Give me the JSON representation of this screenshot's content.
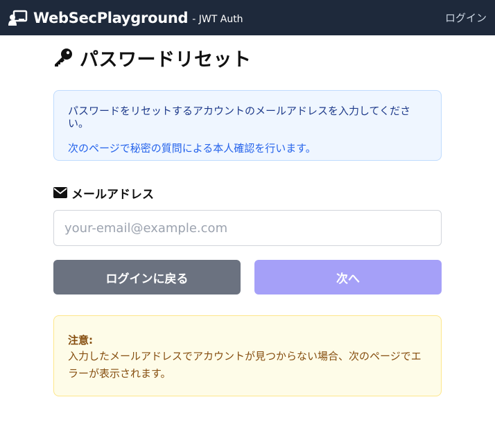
{
  "navbar": {
    "brand_title": "WebSecPlayground",
    "brand_sub": "- JWT Auth",
    "login_link": "ログイン",
    "brand_icon": "chalkboard-user-icon"
  },
  "page": {
    "title": "パスワードリセット",
    "title_icon": "key-icon"
  },
  "info": {
    "line1": "パスワードをリセットするアカウントのメールアドレスを入力してください。",
    "line2": "次のページで秘密の質問による本人確認を行います。"
  },
  "form": {
    "email_label": "メールアドレス",
    "email_icon": "envelope-icon",
    "email_placeholder": "your-email@example.com",
    "email_value": ""
  },
  "buttons": {
    "back": "ログインに戻る",
    "next": "次へ"
  },
  "notice": {
    "title": "注意:",
    "text": "入力したメールアドレスでアカウントが見つからない場合、次のページでエラーが表示されます。"
  },
  "colors": {
    "navbar_bg": "#1e293b",
    "back_button": "#6b7280",
    "next_button": "#a5a0f8",
    "info_bg": "#eff6ff",
    "notice_bg": "#fefce8"
  }
}
